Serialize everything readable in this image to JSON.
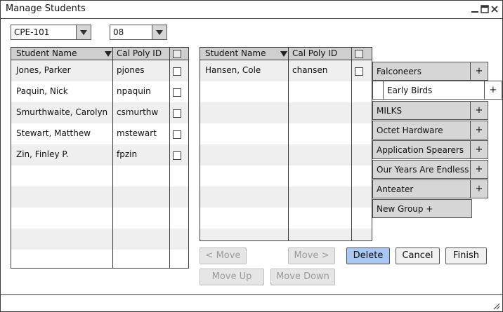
{
  "window": {
    "title": "Manage Students"
  },
  "filters": {
    "course": "CPE-101",
    "section": "08"
  },
  "left_table": {
    "headers": {
      "name": "Student Name",
      "id": "Cal Poly ID"
    },
    "rows": [
      {
        "name": "Jones, Parker",
        "id": "pjones"
      },
      {
        "name": "Paquin, Nick",
        "id": "npaquin"
      },
      {
        "name": "Smurthwaite, Carolyn",
        "id": "csmurthw"
      },
      {
        "name": "Stewart, Matthew",
        "id": "mstewart"
      },
      {
        "name": "Zin, Finley P.",
        "id": "fpzin"
      }
    ]
  },
  "right_table": {
    "headers": {
      "name": "Student Name",
      "id": "Cal Poly ID"
    },
    "rows": [
      {
        "name": "Hansen, Cole",
        "id": "chansen"
      }
    ]
  },
  "groups": [
    {
      "label": "Falconeers",
      "plus": "+"
    },
    {
      "label": "Early Birds",
      "plus": "+"
    },
    {
      "label": "MILKS",
      "plus": "+"
    },
    {
      "label": "Octet Hardware",
      "plus": "+"
    },
    {
      "label": "Application Spearers",
      "plus": "+"
    },
    {
      "label": "Our Years Are Endless",
      "plus": "+"
    },
    {
      "label": "Anteater",
      "plus": "+"
    },
    {
      "label": "New Group +"
    }
  ],
  "buttons": {
    "move_left": "< Move",
    "move_right": "Move >",
    "delete": "Delete",
    "cancel": "Cancel",
    "finish": "Finish",
    "move_up": "Move Up",
    "move_down": "Move Down"
  }
}
